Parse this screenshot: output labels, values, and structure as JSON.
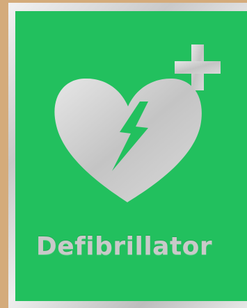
{
  "sign": {
    "label": "Defibrillator",
    "colors": {
      "green": "#22c05e",
      "silver": "#c9c9c9",
      "background": "#d4ab7b"
    },
    "icons": [
      "heart-icon",
      "lightning-bolt-icon",
      "plus-cross-icon"
    ]
  }
}
